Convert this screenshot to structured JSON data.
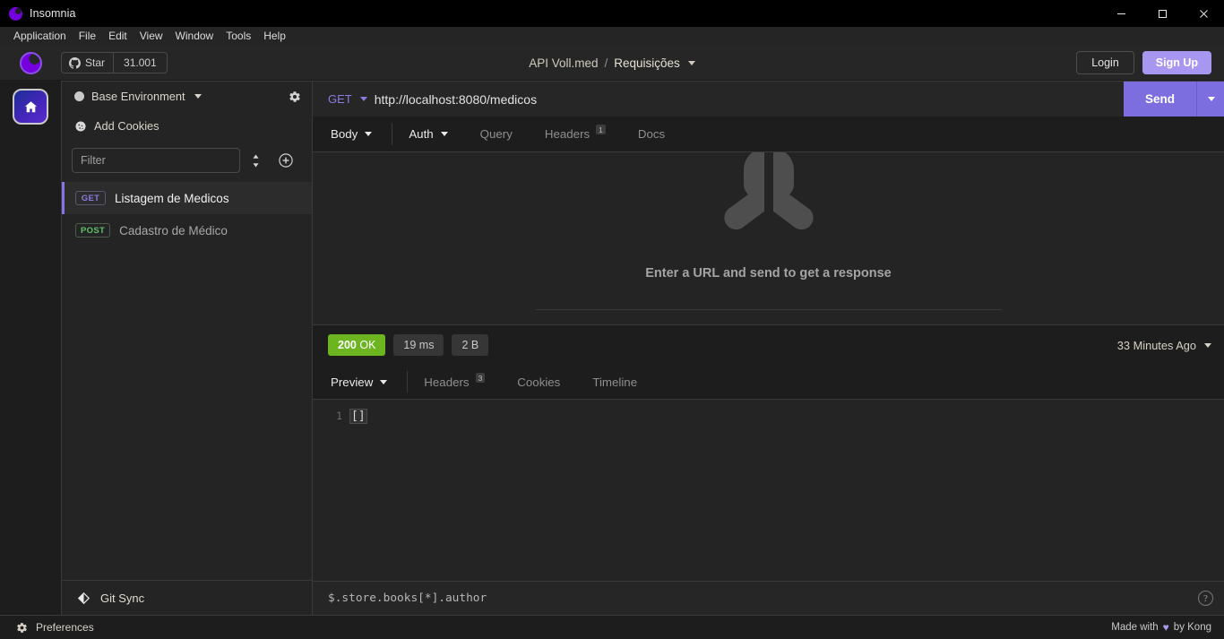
{
  "window": {
    "title": "Insomnia",
    "controls": {
      "minimize": "minimize-icon",
      "maximize": "maximize-icon",
      "close": "close-icon"
    }
  },
  "menubar": {
    "items": [
      "Application",
      "File",
      "Edit",
      "View",
      "Window",
      "Tools",
      "Help"
    ]
  },
  "appheader": {
    "star_label": "Star",
    "star_count": "31.001",
    "breadcrumb": {
      "workspace": "API Voll.med",
      "separator": "/",
      "current": "Requisições"
    },
    "login_label": "Login",
    "signup_label": "Sign Up"
  },
  "sidebar": {
    "environment": "Base Environment",
    "cookies": "Add Cookies",
    "filter_placeholder": "Filter",
    "requests": [
      {
        "method": "GET",
        "name": "Listagem de Medicos",
        "active": true
      },
      {
        "method": "POST",
        "name": "Cadastro de Médico",
        "active": false
      }
    ],
    "git_sync": "Git Sync"
  },
  "request": {
    "method": "GET",
    "url": "http://localhost:8080/medicos",
    "send_label": "Send",
    "tabs": [
      {
        "label": "Body",
        "caret": true,
        "selected": true,
        "badge": ""
      },
      {
        "label": "Auth",
        "caret": true,
        "selected": false,
        "badge": ""
      },
      {
        "label": "Query",
        "caret": false,
        "selected": false,
        "badge": ""
      },
      {
        "label": "Headers",
        "caret": false,
        "selected": false,
        "badge": "1"
      },
      {
        "label": "Docs",
        "caret": false,
        "selected": false,
        "badge": ""
      }
    ],
    "empty_message": "Enter a URL and send to get a response"
  },
  "response": {
    "status_code": "200",
    "status_text": "OK",
    "time": "19 ms",
    "size": "2 B",
    "timeago": "33 Minutes Ago",
    "tabs": [
      {
        "label": "Preview",
        "caret": true,
        "selected": true,
        "badge": ""
      },
      {
        "label": "Headers",
        "caret": false,
        "selected": false,
        "badge": "3"
      },
      {
        "label": "Cookies",
        "caret": false,
        "selected": false,
        "badge": ""
      },
      {
        "label": "Timeline",
        "caret": false,
        "selected": false,
        "badge": ""
      }
    ],
    "body_lines": [
      {
        "num": "1",
        "text": "[]"
      }
    ],
    "filter_placeholder": "$.store.books[*].author",
    "filter_value": "",
    "help_glyph": "?"
  },
  "statusbar": {
    "preferences": "Preferences",
    "made_with_prefix": "Made with",
    "heart": "♥",
    "made_with_suffix": "by Kong"
  },
  "colors": {
    "accent_purple": "#7d6ee0",
    "signup_purple": "#a897f0",
    "status_green": "#6cb521",
    "method_get": "#8d7ae0",
    "method_post": "#5ec16a"
  }
}
